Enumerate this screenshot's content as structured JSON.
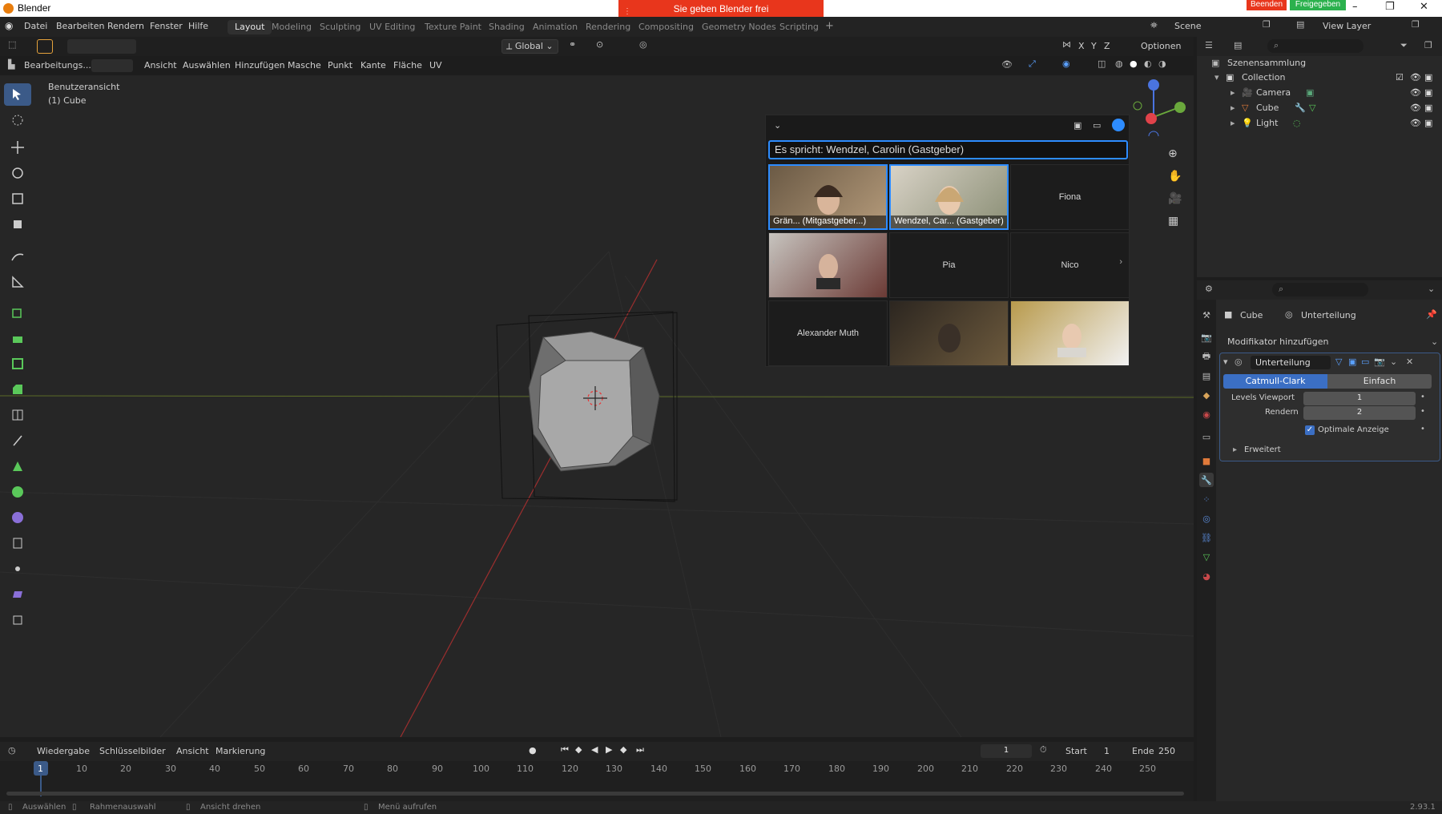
{
  "window": {
    "title": "Blender",
    "share_banner": "Sie geben Blender frei",
    "btn_end": "Beenden",
    "btn_shared": "Freigegeben"
  },
  "menu": [
    "Datei",
    "Bearbeiten",
    "Rendern",
    "Fenster",
    "Hilfe"
  ],
  "workspaces": [
    "Layout",
    "Modeling",
    "Sculpting",
    "UV Editing",
    "Texture Paint",
    "Shading",
    "Animation",
    "Rendering",
    "Compositing",
    "Geometry Nodes",
    "Scripting"
  ],
  "scene": {
    "scene_name": "Scene",
    "view_layer": "View Layer"
  },
  "header1": {
    "orientation": "Global",
    "options": "Optionen",
    "axes": [
      "X",
      "Y",
      "Z"
    ]
  },
  "header2": {
    "mode": "Bearbeitungs...",
    "menus": [
      "Ansicht",
      "Auswählen",
      "Hinzufügen",
      "Masche",
      "Punkt",
      "Kante",
      "Fläche",
      "UV"
    ]
  },
  "viewport": {
    "view_name": "Benutzeransicht",
    "object_info": "(1) Cube"
  },
  "meeting": {
    "speaker_prefix": "Es spricht: ",
    "speaker_name": "Wendzel, Carolin (Gastgeber)",
    "tiles": [
      {
        "caption": "Grän... (Mitgastgeber...)",
        "video": true
      },
      {
        "caption": "Wendzel, Car... (Gastgeber)",
        "video": true
      },
      {
        "caption": "Fiona",
        "video": false
      },
      {
        "caption": "",
        "video": true
      },
      {
        "caption": "Pia",
        "video": false
      },
      {
        "caption": "Nico",
        "video": false
      },
      {
        "caption": "Alexander Muth",
        "video": false
      },
      {
        "caption": "",
        "video": true
      },
      {
        "caption": "",
        "video": true
      }
    ]
  },
  "outliner": {
    "root": "Szenensammlung",
    "collection": "Collection",
    "items": [
      "Camera",
      "Cube",
      "Light"
    ]
  },
  "properties": {
    "object": "Cube",
    "modifier_ref": "Unterteilung",
    "add_modifier": "Modifikator hinzufügen",
    "modifier_name": "Unterteilung",
    "type_a": "Catmull-Clark",
    "type_b": "Einfach",
    "levels_label": "Levels Viewport",
    "levels_value": "1",
    "render_label": "Rendern",
    "render_value": "2",
    "optimal_label": "Optimale Anzeige",
    "advanced_label": "Erweitert"
  },
  "timeline": {
    "menus": [
      "Wiedergabe",
      "Schlüsselbilder",
      "Ansicht",
      "Markierung"
    ],
    "current_frame": "1",
    "start_label": "Start",
    "start_value": "1",
    "end_label": "Ende",
    "end_value": "250",
    "ticks": [
      "1",
      "10",
      "20",
      "30",
      "40",
      "50",
      "60",
      "70",
      "80",
      "90",
      "100",
      "110",
      "120",
      "130",
      "140",
      "150",
      "160",
      "170",
      "180",
      "190",
      "200",
      "210",
      "220",
      "230",
      "240",
      "250"
    ]
  },
  "status": {
    "select": "Auswählen",
    "box": "Rahmenauswahl",
    "rotate": "Ansicht drehen",
    "menu": "Menü aufrufen",
    "version": "2.93.1"
  },
  "colors": {
    "accent": "#2d8cff",
    "active_tab": "#3b5a88",
    "banner": "#e8361c",
    "shared": "#2bb14d"
  }
}
